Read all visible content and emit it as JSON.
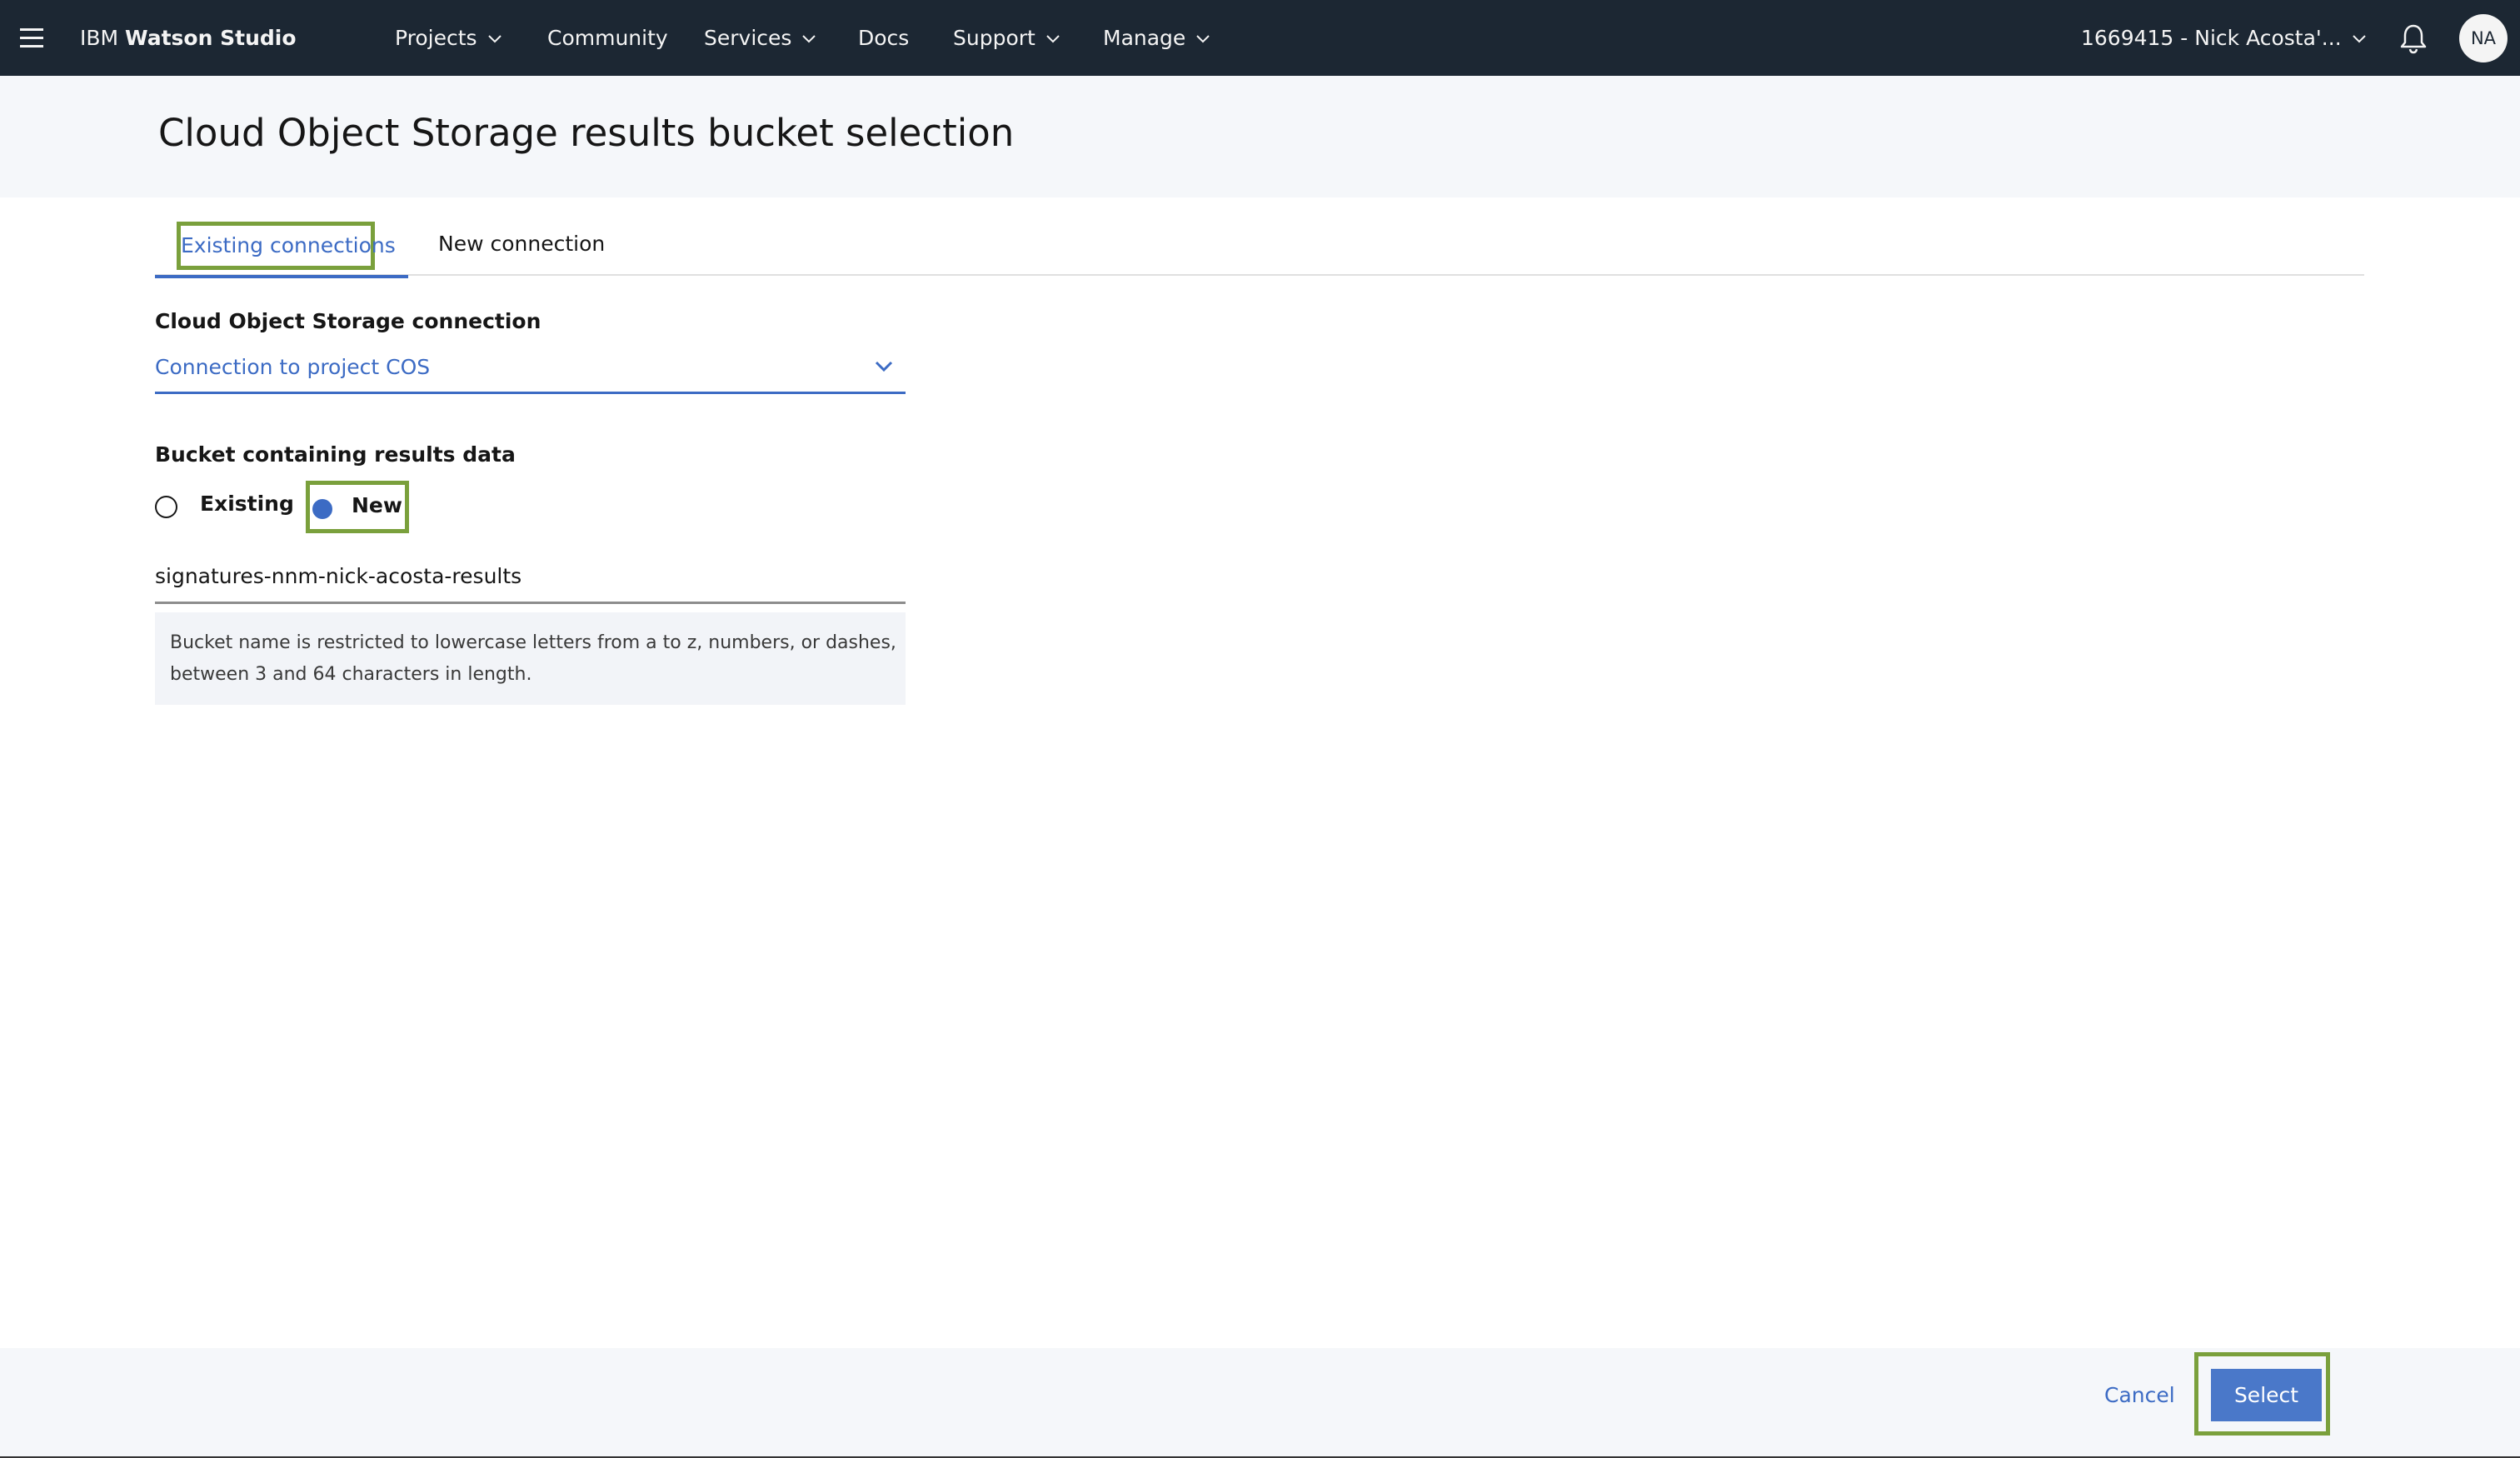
{
  "topbar": {
    "brand_prefix": "IBM",
    "brand_name": "Watson Studio",
    "nav": {
      "projects": "Projects",
      "community": "Community",
      "services": "Services",
      "docs": "Docs",
      "support": "Support",
      "manage": "Manage"
    },
    "account": "1669415 - Nick Acosta'...",
    "avatar_initials": "NA"
  },
  "page": {
    "title": "Cloud Object Storage results bucket selection"
  },
  "tabs": {
    "existing": "Existing connections",
    "new": "New connection"
  },
  "form": {
    "connection_label": "Cloud Object Storage connection",
    "connection_value": "Connection to project COS",
    "bucket_label": "Bucket containing results data",
    "radio_existing": "Existing",
    "radio_new": "New",
    "radio_selected": "New",
    "bucket_name": "signatures-nnm-nick-acosta-results",
    "helper_line1": "Bucket name is restricted to lowercase letters from a to z, numbers, or dashes,",
    "helper_line2": "between 3 and 64 characters in length."
  },
  "footer": {
    "cancel": "Cancel",
    "select": "Select"
  },
  "colors": {
    "topbar_bg": "#1c2733",
    "accent": "#3c6bc4",
    "highlight_outline": "#7aa03c",
    "primary_button": "#4a78c9"
  }
}
